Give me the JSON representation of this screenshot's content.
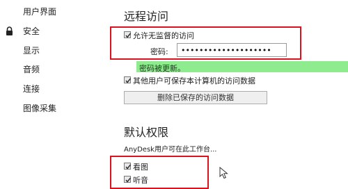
{
  "sidebar": {
    "items": [
      {
        "label": "用户界面"
      },
      {
        "label": "安全",
        "icon": "lock-icon"
      },
      {
        "label": "显示"
      },
      {
        "label": "音频"
      },
      {
        "label": "连接"
      },
      {
        "label": "图像采集"
      }
    ]
  },
  "remote_access": {
    "title": "远程访问",
    "allow_unattended": {
      "label": "允许无监督的访问",
      "checked": true
    },
    "password": {
      "label": "密码:",
      "value": "••••••••••••••••••••"
    },
    "notice": "密码被更新。",
    "other_users_save": {
      "label": "其他用户可保存本计算机的访问数据",
      "checked": true
    },
    "delete_saved_button": "删除已保存的访问数据"
  },
  "default_permissions": {
    "title": "默认权限",
    "description": "AnyDesk用户可在此工作台...",
    "items": [
      {
        "label": "看图",
        "checked": true
      },
      {
        "label": "听音",
        "checked": true
      }
    ]
  },
  "colors": {
    "highlight_box": "#d9121b",
    "notice_bg": "#8eeb8e"
  }
}
